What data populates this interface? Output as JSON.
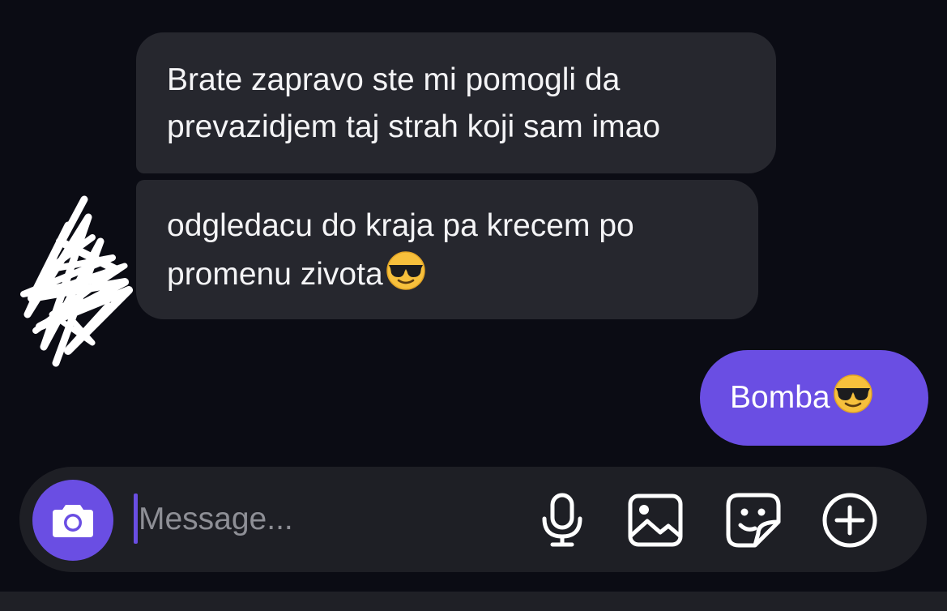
{
  "conversation": {
    "incoming": [
      {
        "lines": [
          "Brate zapravo ste mi pomogli da",
          "prevazidjem taj strah koji sam imao"
        ]
      },
      {
        "lines": [
          "odgledacu do kraja pa krecem po",
          "promenu zivota"
        ],
        "trailing_emoji": "smiling-face-with-sunglasses"
      }
    ],
    "outgoing": [
      {
        "text": "Bomba",
        "trailing_emoji": "smiling-face-with-sunglasses"
      }
    ]
  },
  "composer": {
    "placeholder": "Message...",
    "value": "",
    "left_button_icon": "camera-icon",
    "tool_icons": [
      "microphone-icon",
      "image-icon",
      "sticker-icon",
      "plus-circle-icon"
    ]
  },
  "colors": {
    "background": "#0b0c14",
    "incoming_bubble": "#26272e",
    "outgoing_bubble": "#6a4ee3",
    "accent": "#6a4ee3",
    "composer": "#1e1f25"
  }
}
